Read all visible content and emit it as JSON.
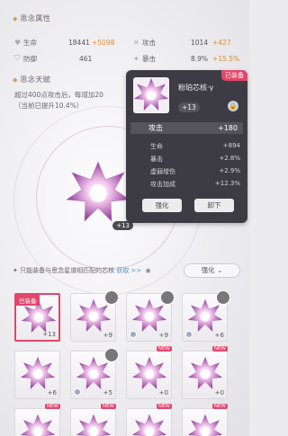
{
  "sections": {
    "attrs_title": "思念属性",
    "talent_title": "思念天赋"
  },
  "stats": [
    {
      "icon": "heart-icon",
      "label": "生命",
      "value": "18441",
      "bonus": "+5098"
    },
    {
      "icon": "sword-icon",
      "label": "攻击",
      "value": "1014",
      "bonus": "+427"
    },
    {
      "icon": "shield-icon",
      "label": "防御",
      "value": "461",
      "bonus": ""
    },
    {
      "icon": "crit-icon",
      "label": "暴击",
      "value": "8.9%",
      "bonus": "+15.5%"
    }
  ],
  "talent": {
    "line1": "超过400点攻击后，每增加20",
    "line2": "（当前已提升10.4%）"
  },
  "main_core": {
    "level": "+13"
  },
  "popup": {
    "equipped": "已装备",
    "name": "粉珀芯核·γ",
    "level": "+13",
    "main_stat": {
      "label": "攻击",
      "value": "+180"
    },
    "sub_stats": [
      {
        "label": "生命",
        "value": "+894"
      },
      {
        "label": "暴击",
        "value": "+2.8%"
      },
      {
        "label": "虚弱增伤",
        "value": "+2.9%"
      },
      {
        "label": "攻击加成",
        "value": "+12.3%"
      }
    ],
    "enhance": "强化",
    "unequip": "卸下"
  },
  "hint": {
    "text": "只能装备与思念星谱相匹配的芯核",
    "link": "获取"
  },
  "sort": {
    "label": "强化"
  },
  "cards": [
    {
      "level": "+13",
      "tag": "已装备",
      "new": "",
      "avatar": false,
      "lock": false
    },
    {
      "level": "+9",
      "tag": "",
      "new": "",
      "avatar": true,
      "lock": false
    },
    {
      "level": "+9",
      "tag": "",
      "new": "",
      "avatar": true,
      "lock": true
    },
    {
      "level": "+6",
      "tag": "",
      "new": "",
      "avatar": true,
      "lock": true
    },
    {
      "level": "+6",
      "tag": "",
      "new": "",
      "avatar": false,
      "lock": false
    },
    {
      "level": "+5",
      "tag": "",
      "new": "",
      "avatar": true,
      "lock": true
    },
    {
      "level": "+0",
      "tag": "",
      "new": "NEW",
      "avatar": false,
      "lock": false
    },
    {
      "level": "+0",
      "tag": "",
      "new": "NEW",
      "avatar": false,
      "lock": false
    },
    {
      "level": "",
      "tag": "",
      "new": "NEW",
      "avatar": false,
      "lock": false
    },
    {
      "level": "",
      "tag": "",
      "new": "NEW",
      "avatar": false,
      "lock": false
    },
    {
      "level": "",
      "tag": "",
      "new": "NEW",
      "avatar": false,
      "lock": false
    },
    {
      "level": "",
      "tag": "",
      "new": "NEW",
      "avatar": false,
      "lock": false
    }
  ],
  "colors": {
    "accent": "#e2466a",
    "bonus": "#e88a2c",
    "link": "#4f8fd9"
  }
}
